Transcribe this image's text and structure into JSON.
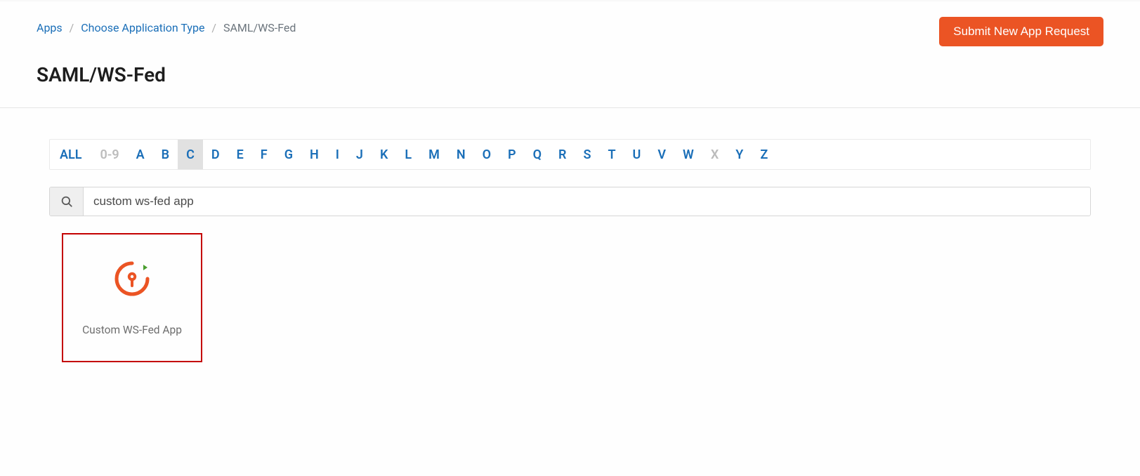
{
  "breadcrumbs": {
    "apps": "Apps",
    "choose": "Choose Application Type",
    "current": "SAML/WS-Fed"
  },
  "header": {
    "submit": "Submit New App Request",
    "title": "SAML/WS-Fed"
  },
  "filters": {
    "all": "ALL",
    "items": [
      {
        "label": "0-9",
        "state": "disabled"
      },
      {
        "label": "A",
        "state": "normal"
      },
      {
        "label": "B",
        "state": "normal"
      },
      {
        "label": "C",
        "state": "active"
      },
      {
        "label": "D",
        "state": "normal"
      },
      {
        "label": "E",
        "state": "normal"
      },
      {
        "label": "F",
        "state": "normal"
      },
      {
        "label": "G",
        "state": "normal"
      },
      {
        "label": "H",
        "state": "normal"
      },
      {
        "label": "I",
        "state": "normal"
      },
      {
        "label": "J",
        "state": "normal"
      },
      {
        "label": "K",
        "state": "normal"
      },
      {
        "label": "L",
        "state": "normal"
      },
      {
        "label": "M",
        "state": "normal"
      },
      {
        "label": "N",
        "state": "normal"
      },
      {
        "label": "O",
        "state": "normal"
      },
      {
        "label": "P",
        "state": "normal"
      },
      {
        "label": "Q",
        "state": "normal"
      },
      {
        "label": "R",
        "state": "normal"
      },
      {
        "label": "S",
        "state": "normal"
      },
      {
        "label": "T",
        "state": "normal"
      },
      {
        "label": "U",
        "state": "normal"
      },
      {
        "label": "V",
        "state": "normal"
      },
      {
        "label": "W",
        "state": "normal"
      },
      {
        "label": "X",
        "state": "disabled"
      },
      {
        "label": "Y",
        "state": "normal"
      },
      {
        "label": "Z",
        "state": "normal"
      }
    ]
  },
  "search": {
    "value": "custom ws-fed app"
  },
  "results": [
    {
      "name": "Custom WS-Fed App",
      "highlighted": true
    }
  ],
  "colors": {
    "accent": "#eb5424",
    "link": "#1b6fb8",
    "highlight_border": "#c40000"
  }
}
